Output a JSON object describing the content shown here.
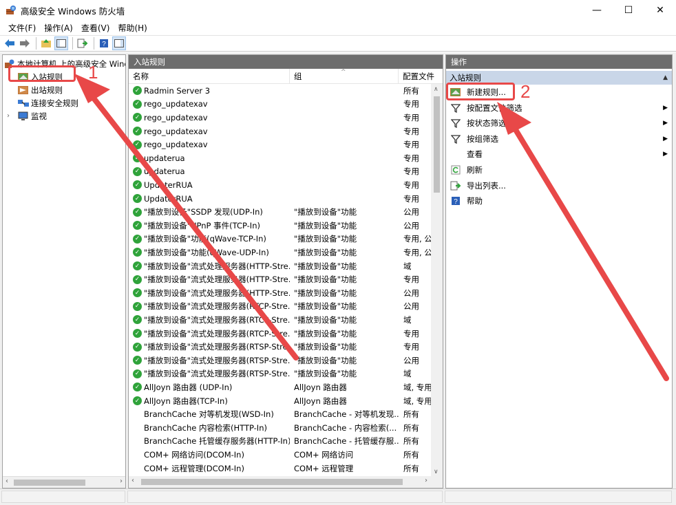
{
  "window": {
    "title": "高级安全 Windows 防火墙",
    "minimize": "—",
    "maximize": "☐",
    "close": "✕"
  },
  "menu": [
    "文件(F)",
    "操作(A)",
    "查看(V)",
    "帮助(H)"
  ],
  "tree": {
    "root": "本地计算机 上的高级安全 Windo",
    "items": [
      "入站规则",
      "出站规则",
      "连接安全规则",
      "监视"
    ]
  },
  "list": {
    "header": "入站规则",
    "columns": [
      "名称",
      "组",
      "配置文件"
    ],
    "rows": [
      {
        "name": "Radmin Server 3",
        "group": "",
        "profile": "所有",
        "enabled": true
      },
      {
        "name": "rego_updatexav",
        "group": "",
        "profile": "专用",
        "enabled": true
      },
      {
        "name": "rego_updatexav",
        "group": "",
        "profile": "专用",
        "enabled": true
      },
      {
        "name": "rego_updatexav",
        "group": "",
        "profile": "专用",
        "enabled": true
      },
      {
        "name": "rego_updatexav",
        "group": "",
        "profile": "专用",
        "enabled": true
      },
      {
        "name": "updaterua",
        "group": "",
        "profile": "专用",
        "enabled": true
      },
      {
        "name": "updaterua",
        "group": "",
        "profile": "专用",
        "enabled": true
      },
      {
        "name": "UpdaterRUA",
        "group": "",
        "profile": "专用",
        "enabled": true
      },
      {
        "name": "UpdaterRUA",
        "group": "",
        "profile": "专用",
        "enabled": true
      },
      {
        "name": "\"播放到设备\"SSDP 发现(UDP-In)",
        "group": "\"播放到设备\"功能",
        "profile": "公用",
        "enabled": true
      },
      {
        "name": "\"播放到设备\"UPnP 事件(TCP-In)",
        "group": "\"播放到设备\"功能",
        "profile": "公用",
        "enabled": true
      },
      {
        "name": "\"播放到设备\"功能(qWave-TCP-In)",
        "group": "\"播放到设备\"功能",
        "profile": "专用, 公",
        "enabled": true
      },
      {
        "name": "\"播放到设备\"功能(qWave-UDP-In)",
        "group": "\"播放到设备\"功能",
        "profile": "专用, 公",
        "enabled": true
      },
      {
        "name": "\"播放到设备\"流式处理服务器(HTTP-Stre...",
        "group": "\"播放到设备\"功能",
        "profile": "域",
        "enabled": true
      },
      {
        "name": "\"播放到设备\"流式处理服务器(HTTP-Stre...",
        "group": "\"播放到设备\"功能",
        "profile": "专用",
        "enabled": true
      },
      {
        "name": "\"播放到设备\"流式处理服务器(HTTP-Stre...",
        "group": "\"播放到设备\"功能",
        "profile": "公用",
        "enabled": true
      },
      {
        "name": "\"播放到设备\"流式处理服务器(RTCP-Stre...",
        "group": "\"播放到设备\"功能",
        "profile": "公用",
        "enabled": true
      },
      {
        "name": "\"播放到设备\"流式处理服务器(RTCP-Stre...",
        "group": "\"播放到设备\"功能",
        "profile": "域",
        "enabled": true
      },
      {
        "name": "\"播放到设备\"流式处理服务器(RTCP-Stre...",
        "group": "\"播放到设备\"功能",
        "profile": "专用",
        "enabled": true
      },
      {
        "name": "\"播放到设备\"流式处理服务器(RTSP-Stre...",
        "group": "\"播放到设备\"功能",
        "profile": "专用",
        "enabled": true
      },
      {
        "name": "\"播放到设备\"流式处理服务器(RTSP-Stre...",
        "group": "\"播放到设备\"功能",
        "profile": "公用",
        "enabled": true
      },
      {
        "name": "\"播放到设备\"流式处理服务器(RTSP-Stre...",
        "group": "\"播放到设备\"功能",
        "profile": "域",
        "enabled": true
      },
      {
        "name": "AllJoyn 路由器 (UDP-In)",
        "group": "AllJoyn 路由器",
        "profile": "域, 专用",
        "enabled": true
      },
      {
        "name": "AllJoyn 路由器(TCP-In)",
        "group": "AllJoyn 路由器",
        "profile": "域, 专用",
        "enabled": true
      },
      {
        "name": "BranchCache 对等机发现(WSD-In)",
        "group": "BranchCache - 对等机发现...",
        "profile": "所有",
        "enabled": false
      },
      {
        "name": "BranchCache 内容检索(HTTP-In)",
        "group": "BranchCache - 内容检索(...",
        "profile": "所有",
        "enabled": false
      },
      {
        "name": "BranchCache 托管缓存服务器(HTTP-In)",
        "group": "BranchCache - 托管缓存服...",
        "profile": "所有",
        "enabled": false
      },
      {
        "name": "COM+ 网络访问(DCOM-In)",
        "group": "COM+ 网络访问",
        "profile": "所有",
        "enabled": false
      },
      {
        "name": "COM+ 远程管理(DCOM-In)",
        "group": "COM+ 远程管理",
        "profile": "所有",
        "enabled": false
      }
    ]
  },
  "actions": {
    "header": "操作",
    "section": "入站规则",
    "items": [
      {
        "label": "新建规则...",
        "icon": "new-rule-icon",
        "submenu": false
      },
      {
        "label": "按配置文件筛选",
        "icon": "filter-icon",
        "submenu": true
      },
      {
        "label": "按状态筛选",
        "icon": "filter-icon",
        "submenu": true
      },
      {
        "label": "按组筛选",
        "icon": "filter-icon",
        "submenu": true
      },
      {
        "label": "查看",
        "icon": "",
        "submenu": true
      },
      {
        "label": "刷新",
        "icon": "refresh-icon",
        "submenu": false
      },
      {
        "label": "导出列表...",
        "icon": "export-icon",
        "submenu": false
      },
      {
        "label": "帮助",
        "icon": "help-icon",
        "submenu": false
      }
    ]
  },
  "annotations": {
    "step1": "1",
    "step2": "2",
    "color": "#e84848"
  }
}
